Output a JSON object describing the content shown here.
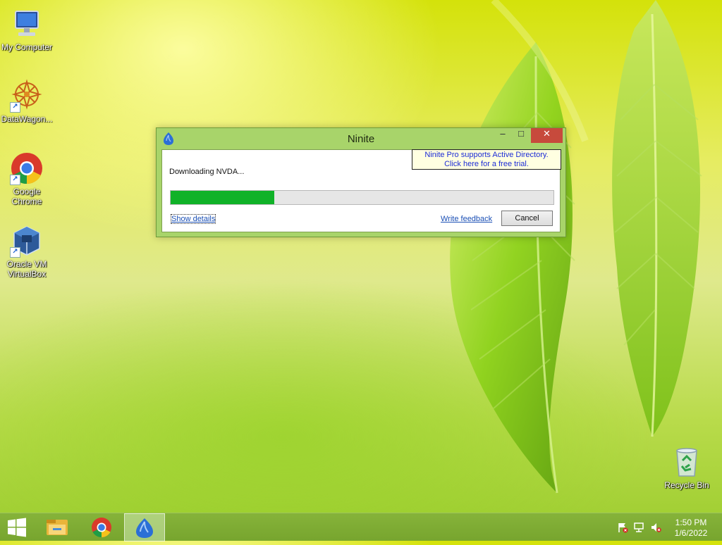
{
  "desktop": {
    "icons": [
      {
        "label": "My Computer",
        "icon": "computer-icon"
      },
      {
        "label": "DataWagon...",
        "icon": "datawagon-icon"
      },
      {
        "label": "Google Chrome",
        "icon": "chrome-icon"
      },
      {
        "label": "Oracle VM VirtualBox",
        "icon": "virtualbox-icon"
      },
      {
        "label": "Recycle Bin",
        "icon": "recycle-bin-icon"
      }
    ]
  },
  "window": {
    "title": "Ninite",
    "minimize_glyph": "–",
    "maximize_glyph": "□",
    "close_glyph": "✕",
    "promo_line1": "Ninite Pro supports Active Directory.",
    "promo_line2": "Click here for a free trial.",
    "status": "Downloading NVDA...",
    "progress_fraction": 0.27,
    "show_details_label": "Show details",
    "feedback_label": "Write feedback",
    "cancel_label": "Cancel"
  },
  "taskbar": {
    "items": [
      "start-icon",
      "file-explorer-icon",
      "chrome-icon",
      "ninite-icon"
    ],
    "tray": [
      "action-center-flag-icon",
      "network-icon",
      "volume-muted-icon"
    ],
    "time": "1:50 PM",
    "date": "1/6/2022"
  },
  "colors": {
    "progress_fill": "#10b228",
    "taskbar": "#7aa932",
    "window_frame": "#a8d46a",
    "close_button": "#c74a3c",
    "promo_link": "#1c2bd6"
  }
}
